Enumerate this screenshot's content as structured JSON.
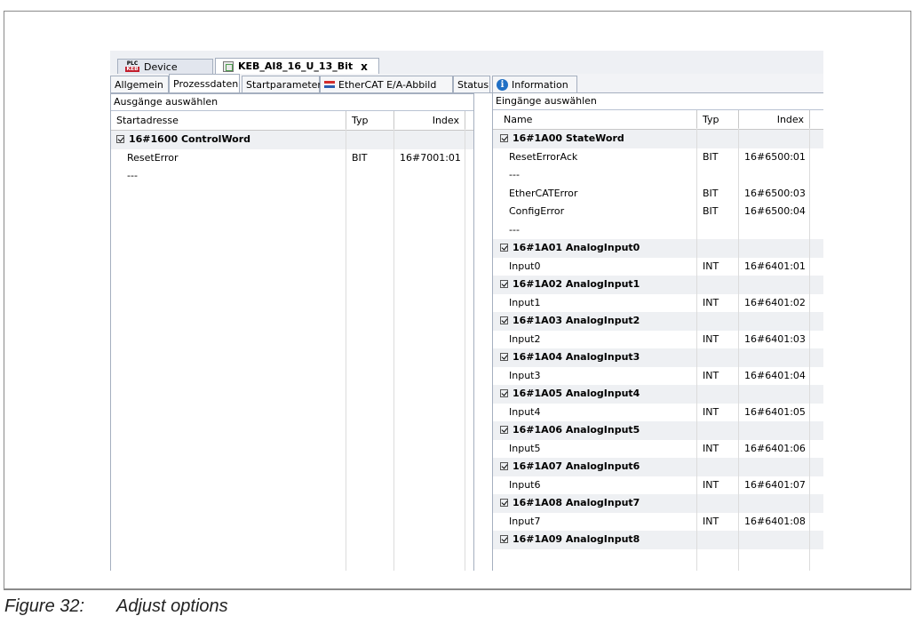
{
  "document_tabs": [
    {
      "label": "Device",
      "icon_top": "PLC",
      "icon_bottom": "KEB"
    },
    {
      "label": "KEB_AI8_16_U_13_Bit",
      "close": "x"
    }
  ],
  "sub_tabs": [
    "Allgemein",
    "Prozessdaten",
    "Startparameter",
    "EtherCAT E/A-Abbild",
    "Status",
    "Information"
  ],
  "outputs": {
    "title": "Ausgänge auswählen",
    "columns": [
      "Startadresse",
      "Typ",
      "Index"
    ],
    "rows": [
      {
        "name": "16#1600 ControlWord",
        "group": true
      },
      {
        "name": "ResetError",
        "type": "BIT",
        "index": "16#7001:01"
      },
      {
        "name": "---"
      }
    ]
  },
  "inputs": {
    "title": "Eingänge auswählen",
    "columns": [
      "Name",
      "Typ",
      "Index"
    ],
    "rows": [
      {
        "name": "16#1A00 StateWord",
        "group": true
      },
      {
        "name": "ResetErrorAck",
        "type": "BIT",
        "index": "16#6500:01"
      },
      {
        "name": "---"
      },
      {
        "name": "EtherCATError",
        "type": "BIT",
        "index": "16#6500:03"
      },
      {
        "name": "ConfigError",
        "type": "BIT",
        "index": "16#6500:04"
      },
      {
        "name": "---"
      },
      {
        "name": "16#1A01 AnalogInput0",
        "group": true
      },
      {
        "name": "Input0",
        "type": "INT",
        "index": "16#6401:01"
      },
      {
        "name": "16#1A02 AnalogInput1",
        "group": true
      },
      {
        "name": "Input1",
        "type": "INT",
        "index": "16#6401:02"
      },
      {
        "name": "16#1A03 AnalogInput2",
        "group": true
      },
      {
        "name": "Input2",
        "type": "INT",
        "index": "16#6401:03"
      },
      {
        "name": "16#1A04 AnalogInput3",
        "group": true
      },
      {
        "name": "Input3",
        "type": "INT",
        "index": "16#6401:04"
      },
      {
        "name": "16#1A05 AnalogInput4",
        "group": true
      },
      {
        "name": "Input4",
        "type": "INT",
        "index": "16#6401:05"
      },
      {
        "name": "16#1A06 AnalogInput5",
        "group": true
      },
      {
        "name": "Input5",
        "type": "INT",
        "index": "16#6401:06"
      },
      {
        "name": "16#1A07 AnalogInput6",
        "group": true
      },
      {
        "name": "Input6",
        "type": "INT",
        "index": "16#6401:07"
      },
      {
        "name": "16#1A08 AnalogInput7",
        "group": true
      },
      {
        "name": "Input7",
        "type": "INT",
        "index": "16#6401:08"
      },
      {
        "name": "16#1A09 AnalogInput8",
        "group": true
      }
    ]
  },
  "caption": {
    "number": "Figure 32:",
    "text": "Adjust options"
  }
}
